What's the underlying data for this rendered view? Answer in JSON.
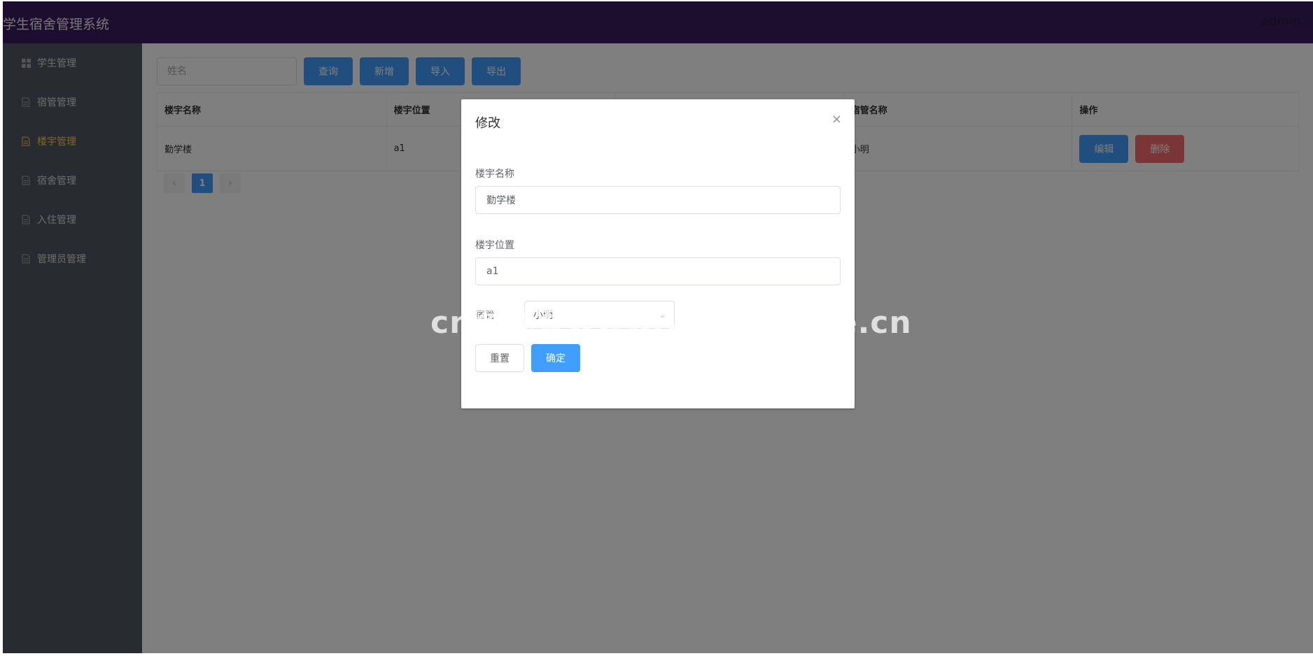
{
  "header": {
    "app_title": "学生宿舍管理系统",
    "user_name": "admin"
  },
  "sidebar": {
    "items": [
      {
        "label": "学生管理",
        "icon": "grid-icon",
        "active": false
      },
      {
        "label": "宿管管理",
        "icon": "document-icon",
        "active": false
      },
      {
        "label": "楼宇管理",
        "icon": "document-icon",
        "active": true
      },
      {
        "label": "宿舍管理",
        "icon": "document-icon",
        "active": false
      },
      {
        "label": "入住管理",
        "icon": "document-icon",
        "active": false
      },
      {
        "label": "管理员管理",
        "icon": "document-icon",
        "active": false
      }
    ]
  },
  "toolbar": {
    "search_placeholder": "姓名",
    "query_label": "查询",
    "add_label": "新增",
    "import_label": "导入",
    "export_label": "导出"
  },
  "table": {
    "columns": [
      "楼宇名称",
      "楼宇位置",
      "",
      "宿管名称",
      "操作"
    ],
    "rows": [
      {
        "name": "勤学楼",
        "location": "a1",
        "col3": "",
        "manager": "小明"
      }
    ],
    "edit_label": "编辑",
    "delete_label": "删除"
  },
  "pager": {
    "prev": "‹",
    "current": "1",
    "next": "›"
  },
  "dialog": {
    "title": "修改",
    "close": "×",
    "name_label": "楼宇名称",
    "name_value": "勤学楼",
    "location_label": "楼宇位置",
    "location_value": "a1",
    "manager_label": "宿管",
    "manager_value": "小明",
    "reset_label": "重置",
    "confirm_label": "确定"
  },
  "watermark": "cn图观客www.weiguanke.cn",
  "colors": {
    "header_bg": "#3a1a5e",
    "sidebar_bg": "#50565e",
    "primary": "#409eff",
    "danger": "#f56c6c",
    "active_menu": "#ffd04b"
  }
}
